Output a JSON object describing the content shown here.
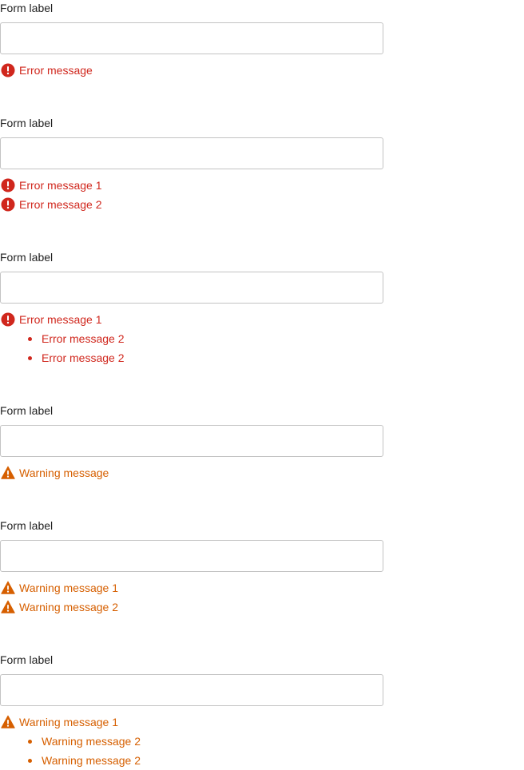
{
  "colors": {
    "error": "#d0271d",
    "warning": "#d65f00",
    "input_border": "#c3c3c3"
  },
  "icons": {
    "error": "error-circle-icon",
    "warning": "warning-triangle-icon"
  },
  "fields": [
    {
      "label": "Form label",
      "value": "",
      "type": "error",
      "messages": [
        "Error message"
      ],
      "bullets": []
    },
    {
      "label": "Form label",
      "value": "",
      "type": "error",
      "messages": [
        "Error message 1",
        "Error message 2"
      ],
      "bullets": []
    },
    {
      "label": "Form label",
      "value": "",
      "type": "error",
      "messages": [
        "Error message 1"
      ],
      "bullets": [
        "Error message 2",
        "Error message 2"
      ]
    },
    {
      "label": "Form label",
      "value": "",
      "type": "warning",
      "messages": [
        "Warning message"
      ],
      "bullets": []
    },
    {
      "label": "Form label",
      "value": "",
      "type": "warning",
      "messages": [
        "Warning message 1",
        "Warning message 2"
      ],
      "bullets": []
    },
    {
      "label": "Form label",
      "value": "",
      "type": "warning",
      "messages": [
        "Warning message 1"
      ],
      "bullets": [
        "Warning message 2",
        "Warning message 2"
      ]
    }
  ]
}
